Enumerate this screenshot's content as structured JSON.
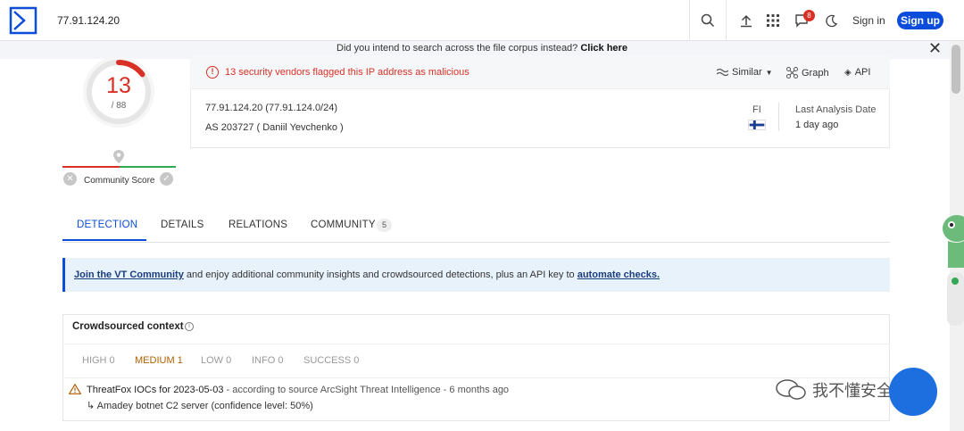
{
  "header": {
    "search_value": "77.91.124.20",
    "notifications_count": "8",
    "signin_label": "Sign in",
    "signup_label": "Sign up"
  },
  "banner": {
    "text": "Did you intend to search across the file corpus instead?",
    "link": "Click here"
  },
  "score": {
    "detections": "13",
    "total": "/ 88",
    "detected_fraction": 0.148,
    "community_label": "Community Score"
  },
  "summary": {
    "alert": "13 security vendors flagged this IP address as malicious",
    "actions": {
      "similar": "Similar",
      "graph": "Graph",
      "api": "API"
    },
    "ip_line": "77.91.124.20  (77.91.124.0/24)",
    "as_line": "AS 203727  ( Daniil Yevchenko )",
    "country_code": "FI",
    "last_analysis_label": "Last Analysis Date",
    "last_analysis_value": "1 day ago"
  },
  "tabs": {
    "detection": "DETECTION",
    "details": "DETAILS",
    "relations": "RELATIONS",
    "community": "COMMUNITY",
    "community_count": "5"
  },
  "join_banner": {
    "link1": "Join the VT Community",
    "middle": " and enjoy additional community insights and crowdsourced detections, plus an API key to ",
    "link2": "automate checks."
  },
  "crowdsourced": {
    "title": "Crowdsourced context",
    "filters": {
      "high": "HIGH 0",
      "medium": "MEDIUM 1",
      "low": "LOW 0",
      "info": "INFO 0",
      "success": "SUCCESS 0"
    },
    "entry_title": "ThreatFox IOCs for 2023-05-03",
    "entry_source": " - according to source ArcSight Threat Intelligence - 6 months ago",
    "entry_detail": "↳ Amadey botnet C2 server (confidence level: 50%)"
  },
  "watermark": {
    "text": "我不懂安全"
  },
  "colors": {
    "accent": "#0b4dda",
    "danger": "#d93025",
    "ok": "#34a853",
    "medium": "#b06000"
  }
}
